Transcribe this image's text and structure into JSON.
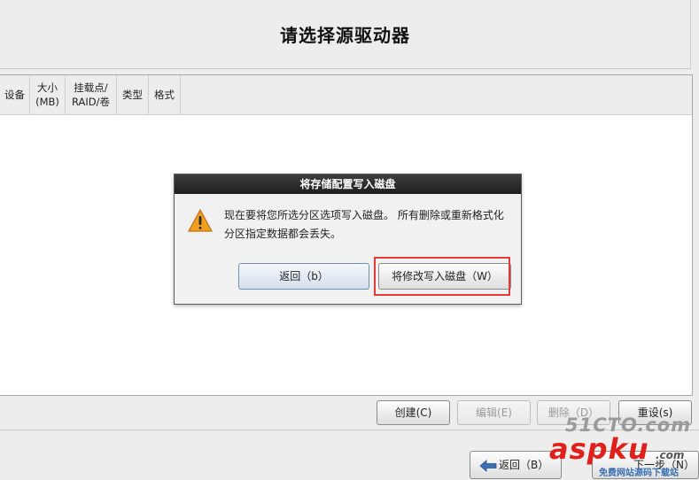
{
  "header": {
    "title": "请选择源驱动器"
  },
  "table": {
    "columns": [
      "设备",
      "大小\n(MB)",
      "挂载点/\nRAID/卷",
      "类型",
      "格式"
    ]
  },
  "dialog": {
    "title": "将存储配置写入磁盘",
    "message": "现在要将您所选分区选项写入磁盘。  所有删除或重新格式化分区指定数据都会丢失。",
    "back_button": "返回（b）",
    "write_button": "将修改写入磁盘（W）"
  },
  "toolbar": {
    "create": "创建(C)",
    "edit": "编辑(E)",
    "delete": "删除（D）",
    "reset": "重设(s)"
  },
  "nav": {
    "back": "返回（B）",
    "next": "下一步（N）"
  },
  "watermark": {
    "top": "51CTO.com",
    "main": "aspku",
    "com": ".com",
    "sub": "免费网站源码下载站"
  },
  "colors": {
    "highlight": "#e03a3a",
    "dialog_title_bg": "#2a2a2a",
    "warning": "#f0a020"
  }
}
